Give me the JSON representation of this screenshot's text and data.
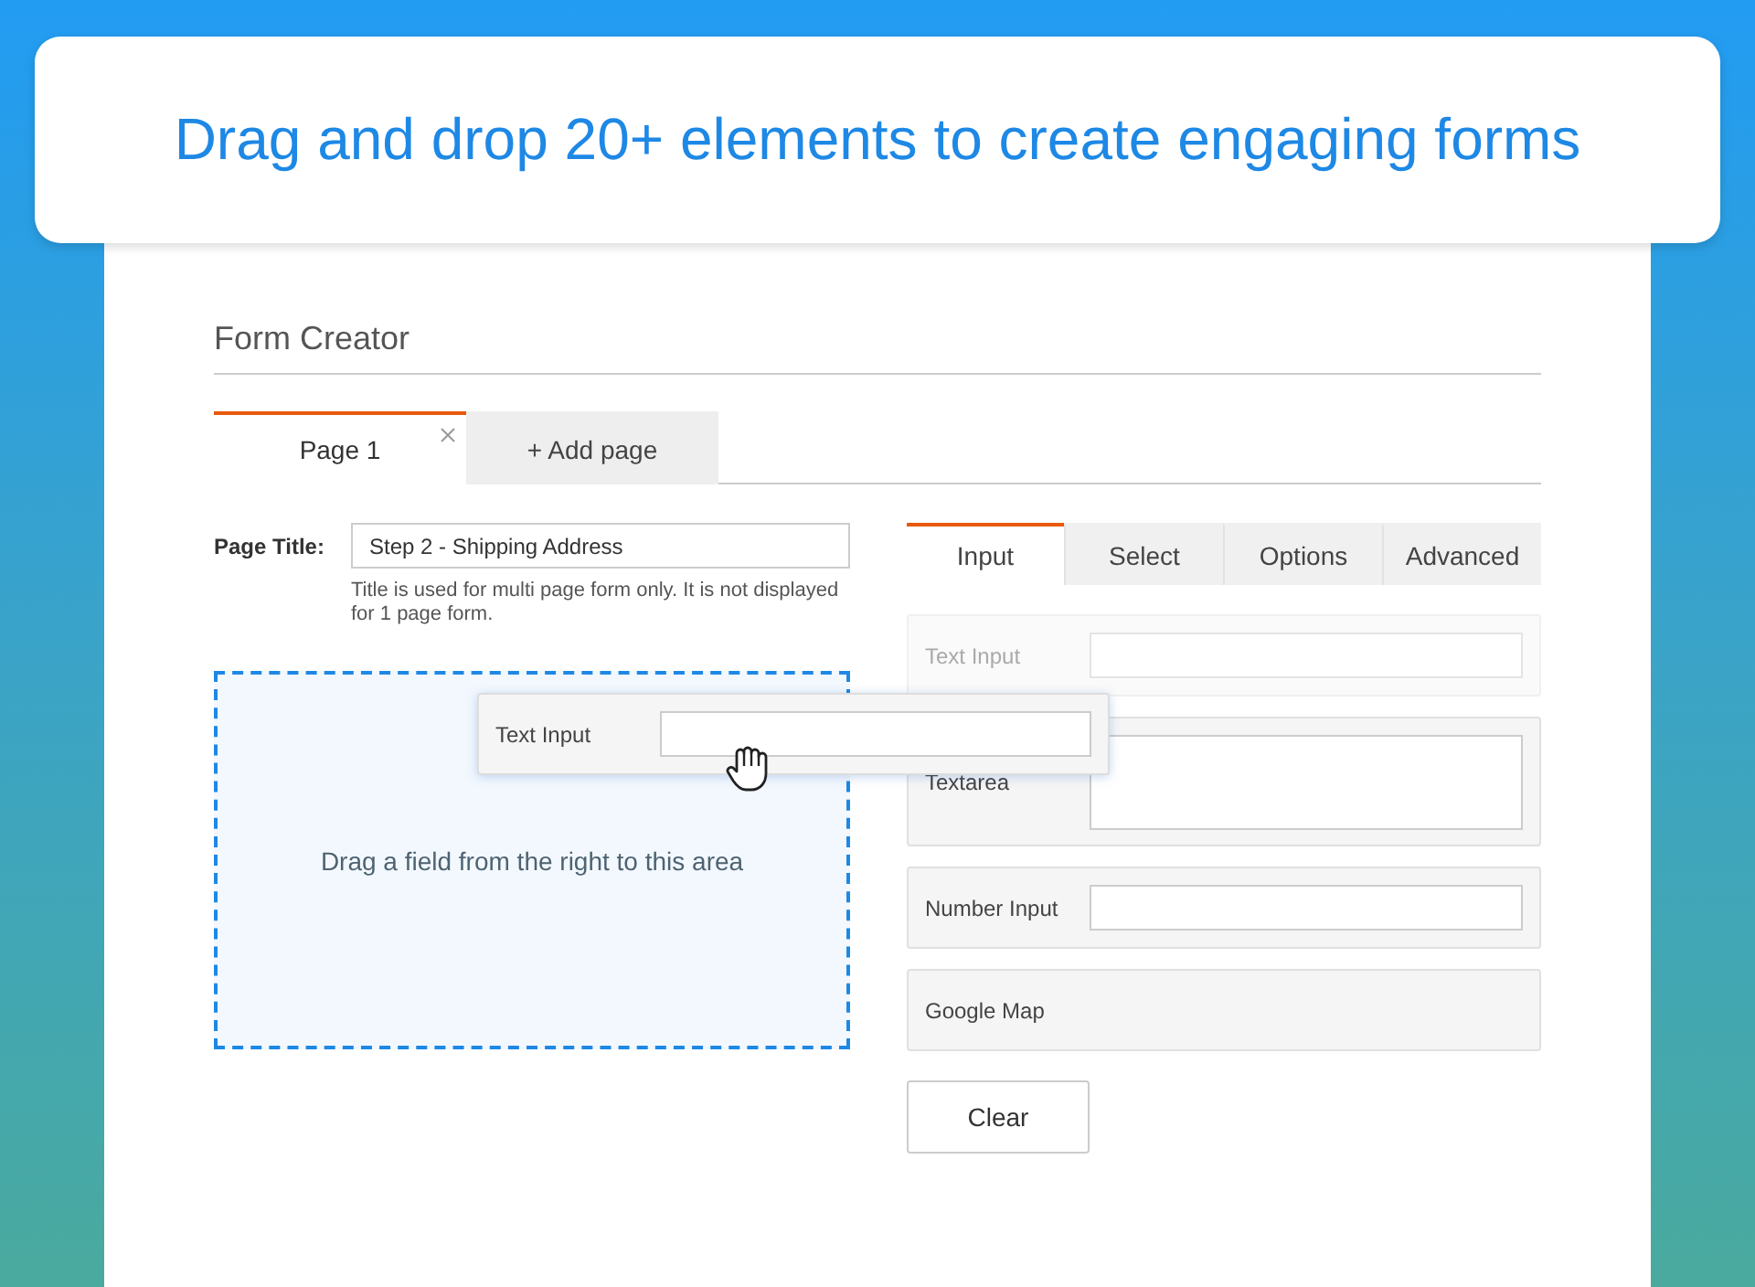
{
  "banner": {
    "headline": "Drag and drop 20+ elements to create engaging forms"
  },
  "form_creator": {
    "title": "Form Creator",
    "page_tabs": [
      {
        "label": "Page 1",
        "selected": true,
        "closable": true
      },
      {
        "label": "+ Add page",
        "selected": false,
        "closable": false
      }
    ],
    "page_title": {
      "label": "Page Title:",
      "value": "Step 2 - Shipping Address",
      "help": "Title is used for multi page form only. It is not displayed for 1 page form."
    },
    "drop_zone": {
      "hint": "Drag a field from the right to this area"
    },
    "dragged_field": {
      "label": "Text Input"
    },
    "palette_tabs": [
      {
        "label": "Input",
        "selected": true
      },
      {
        "label": "Select",
        "selected": false
      },
      {
        "label": "Options",
        "selected": false
      },
      {
        "label": "Advanced",
        "selected": false
      }
    ],
    "palette_fields": [
      {
        "kind": "input",
        "label": "Text Input",
        "dragging": true
      },
      {
        "kind": "textarea",
        "label": "Textarea",
        "dragging": false
      },
      {
        "kind": "input",
        "label": "Number Input",
        "dragging": false
      },
      {
        "kind": "plain",
        "label": "Google Map",
        "dragging": false
      }
    ],
    "clear_button": "Clear"
  }
}
